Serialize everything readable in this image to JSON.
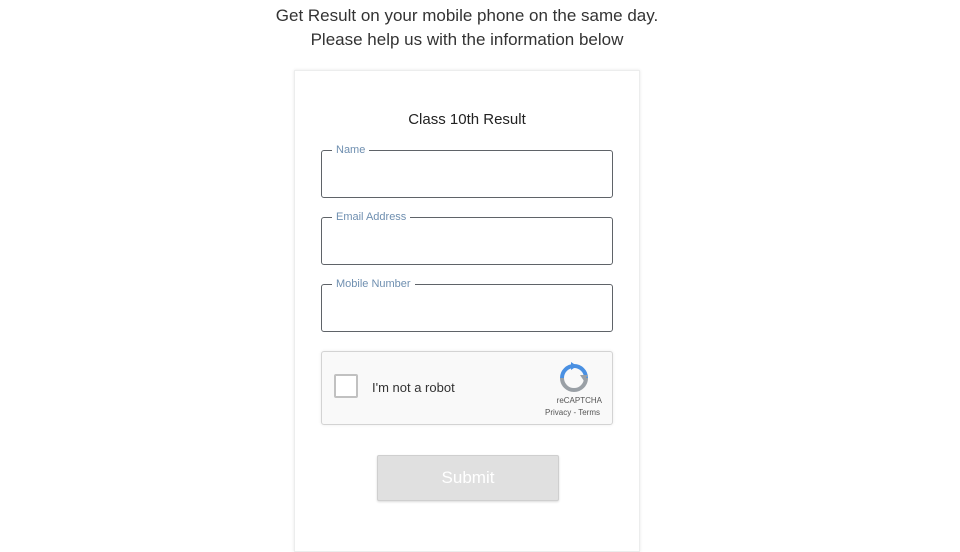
{
  "intro": {
    "line1": "Get Result on your mobile phone on the same day.",
    "line2": "Please help us with the information below"
  },
  "form": {
    "title": "Class 10th Result",
    "fields": [
      {
        "label": "Name",
        "value": ""
      },
      {
        "label": "Email Address",
        "value": ""
      },
      {
        "label": "Mobile Number",
        "value": ""
      }
    ],
    "recaptcha": {
      "label": "I'm not a robot",
      "brand": "reCAPTCHA",
      "links": "Privacy - Terms",
      "icon": "recaptcha-icon"
    },
    "submit_label": "Submit"
  },
  "colors": {
    "field_legend": "#6f8fb0",
    "field_border": "#5f6368",
    "submit_bg": "#e0e0e0",
    "recaptcha_blue": "#4a90e2",
    "recaptcha_gray": "#9aa0a6"
  }
}
